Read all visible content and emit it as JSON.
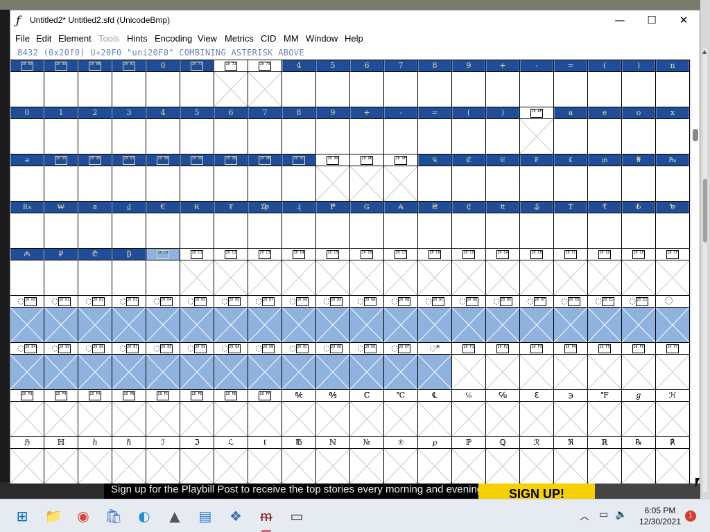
{
  "window": {
    "title": "Untitled2*  Untitled2.sfd (UnicodeBmp)",
    "app_icon": "fontforge-icon",
    "minimize": "—",
    "maximize": "☐",
    "close": "✕"
  },
  "menu": [
    {
      "label": "File",
      "enabled": true
    },
    {
      "label": "Edit",
      "enabled": true
    },
    {
      "label": "Element",
      "enabled": true
    },
    {
      "label": "Tools",
      "enabled": false
    },
    {
      "label": "Hints",
      "enabled": true
    },
    {
      "label": "Encoding",
      "enabled": true
    },
    {
      "label": "View",
      "enabled": true
    },
    {
      "label": "Metrics",
      "enabled": true
    },
    {
      "label": "CID",
      "enabled": true
    },
    {
      "label": "MM",
      "enabled": true
    },
    {
      "label": "Window",
      "enabled": true
    },
    {
      "label": "Help",
      "enabled": true
    }
  ],
  "infoline": "8432 (0x20f0) U+20F0 \"uni20F0\" COMBINING ASTERISK ABOVE",
  "grid": {
    "rows": [
      {
        "labels": [
          "▣",
          "▣",
          "▣",
          "▣",
          "0",
          "▣",
          "▣",
          "▣",
          "4",
          "5",
          "6",
          "7",
          "8",
          "9",
          "+",
          "-",
          "=",
          "(",
          ")",
          "n"
        ],
        "codes": [
          "2089",
          "208A",
          "208B",
          "208C",
          "",
          "2071",
          "2072",
          "2073",
          "",
          "",
          "",
          "",
          "",
          "",
          "",
          "",
          "",
          "",
          "",
          ""
        ],
        "header": [
          1,
          1,
          1,
          1,
          1,
          1,
          0,
          0,
          1,
          1,
          1,
          1,
          1,
          1,
          1,
          1,
          1,
          1,
          1,
          1
        ],
        "crossed": [
          0,
          0,
          0,
          0,
          0,
          0,
          1,
          1,
          0,
          0,
          0,
          0,
          0,
          0,
          0,
          0,
          0,
          0,
          0,
          0
        ]
      },
      {
        "labels": [
          "0",
          "1",
          "2",
          "3",
          "4",
          "5",
          "6",
          "7",
          "8",
          "9",
          "+",
          "-",
          "=",
          "(",
          ")",
          "▣",
          "a",
          "e",
          "o",
          "x"
        ],
        "codes": [
          "",
          "",
          "",
          "",
          "",
          "",
          "",
          "",
          "",
          "",
          "",
          "",
          "",
          "",
          "",
          "208F",
          "",
          "",
          "",
          ""
        ],
        "header": [
          1,
          1,
          1,
          1,
          1,
          1,
          1,
          1,
          1,
          1,
          1,
          1,
          1,
          1,
          1,
          0,
          1,
          1,
          1,
          1
        ],
        "crossed": [
          0,
          0,
          0,
          0,
          0,
          0,
          0,
          0,
          0,
          0,
          0,
          0,
          0,
          0,
          0,
          1,
          0,
          0,
          0,
          0
        ]
      },
      {
        "labels": [
          "ə",
          "▣",
          "▣",
          "▣",
          "▣",
          "▣",
          "▣",
          "▣",
          "▣",
          "▣",
          "▣",
          "▣",
          "₠",
          "₡",
          "₢",
          "₣",
          "₤",
          "₥",
          "₦",
          "₧"
        ],
        "codes": [
          "",
          "2095",
          "2096",
          "2097",
          "2098",
          "2099",
          "209A",
          "209B",
          "209C",
          "209D",
          "209E",
          "209F",
          "",
          "",
          "",
          "",
          "",
          "",
          "",
          ""
        ],
        "header": [
          1,
          1,
          1,
          1,
          1,
          1,
          1,
          1,
          1,
          0,
          0,
          0,
          1,
          1,
          1,
          1,
          1,
          1,
          1,
          1
        ],
        "crossed": [
          0,
          0,
          0,
          0,
          0,
          0,
          0,
          0,
          0,
          1,
          1,
          1,
          0,
          0,
          0,
          0,
          0,
          0,
          0,
          0
        ]
      },
      {
        "labels": [
          "₨",
          "₩",
          "₪",
          "₫",
          "€",
          "₭",
          "₮",
          "₯",
          "₰",
          "₱",
          "₲",
          "₳",
          "₴",
          "₵",
          "₶",
          "₷",
          "₸",
          "₹",
          "₺",
          "₻"
        ],
        "codes": [
          "",
          "",
          "",
          "",
          "",
          "",
          "",
          "",
          "",
          "",
          "",
          "",
          "",
          "",
          "",
          "",
          "",
          "",
          "",
          ""
        ],
        "header": [
          1,
          1,
          1,
          1,
          1,
          1,
          1,
          1,
          1,
          1,
          1,
          1,
          1,
          1,
          1,
          1,
          1,
          1,
          1,
          1
        ],
        "crossed": [
          0,
          0,
          0,
          0,
          0,
          0,
          0,
          0,
          0,
          0,
          0,
          0,
          0,
          0,
          0,
          0,
          0,
          0,
          0,
          0
        ]
      },
      {
        "labels": [
          "₼",
          "₽",
          "₾",
          "₿",
          "▣",
          "▣",
          "▣",
          "▣",
          "▣",
          "▣",
          "▣",
          "▣",
          "▣",
          "▣",
          "▣",
          "▣",
          "▣",
          "▣",
          "▣",
          "▣"
        ],
        "codes": [
          "",
          "",
          "",
          "",
          "20C0",
          "20C1",
          "20C2",
          "20C3",
          "20C4",
          "20C5",
          "20C6",
          "20C7",
          "20C8",
          "20C9",
          "20CA",
          "20CB",
          "20CC",
          "20CD",
          "20CE",
          "20CF"
        ],
        "header": [
          1,
          1,
          1,
          1,
          2,
          0,
          0,
          0,
          0,
          0,
          0,
          0,
          0,
          0,
          0,
          0,
          0,
          0,
          0,
          0
        ],
        "crossed": [
          0,
          0,
          0,
          0,
          0,
          1,
          1,
          1,
          1,
          1,
          1,
          1,
          1,
          1,
          1,
          1,
          1,
          1,
          1,
          1
        ]
      },
      {
        "labels": [
          "◌▣",
          "◌▣",
          "◌▣",
          "◌▣",
          "◌▣",
          "◌▣",
          "◌▣",
          "◌▣",
          "◌▣",
          "◌▣",
          "◌▣",
          "◌▣",
          "◌▣",
          "◌▣",
          "◌▣",
          "◌▣",
          "◌▣",
          "◌▣",
          "◌▣",
          "⃝"
        ],
        "codes": [
          "20D0",
          "20D1",
          "20D2",
          "20D3",
          "20D4",
          "20D5",
          "20D6",
          "20D7",
          "20D8",
          "20D9",
          "20DA",
          "20DB",
          "20DC",
          "20DD",
          "20DE",
          "20DF",
          "20E0",
          "20E1",
          "20E2",
          ""
        ],
        "header": [
          0,
          0,
          0,
          0,
          0,
          0,
          0,
          0,
          0,
          0,
          0,
          0,
          0,
          0,
          0,
          0,
          0,
          0,
          0,
          0
        ],
        "crossed": [
          1,
          1,
          1,
          1,
          1,
          1,
          1,
          1,
          1,
          1,
          1,
          1,
          1,
          1,
          1,
          1,
          1,
          1,
          1,
          1
        ],
        "selected": [
          1,
          1,
          1,
          1,
          1,
          1,
          1,
          1,
          1,
          1,
          1,
          1,
          1,
          1,
          1,
          1,
          1,
          1,
          1,
          1
        ]
      },
      {
        "labels": [
          "◌▣",
          "◌▣",
          "◌▣",
          "◌▣",
          "◌▣",
          "◌▣",
          "◌▣",
          "◌▣",
          "◌▣",
          "◌▣",
          "◌▣",
          "◌▣",
          "◌*",
          "▣",
          "▣",
          "▣",
          "▣",
          "▣",
          "▣",
          "▣"
        ],
        "codes": [
          "20E4",
          "20E5",
          "20E6",
          "20E7",
          "20E8",
          "20E9",
          "20EA",
          "20EB",
          "20EC",
          "20ED",
          "20EE",
          "20EF",
          "",
          "20F1",
          "20F2",
          "20F3",
          "20F4",
          "20F5",
          "20F6",
          "20F7"
        ],
        "header": [
          0,
          0,
          0,
          0,
          0,
          0,
          0,
          0,
          0,
          0,
          0,
          0,
          0,
          0,
          0,
          0,
          0,
          0,
          0,
          0
        ],
        "crossed": [
          1,
          1,
          1,
          1,
          1,
          1,
          1,
          1,
          1,
          1,
          1,
          1,
          1,
          1,
          1,
          1,
          1,
          1,
          1,
          1
        ],
        "selected": [
          1,
          1,
          1,
          1,
          1,
          1,
          1,
          1,
          1,
          1,
          1,
          1,
          1,
          0,
          0,
          0,
          0,
          0,
          0,
          0
        ]
      },
      {
        "labels": [
          "▣",
          "▣",
          "▣",
          "▣",
          "▣",
          "▣",
          "▣",
          "▣",
          "℀",
          "℁",
          "ℂ",
          "℃",
          "℄",
          "℅",
          "℆",
          "ℇ",
          "℈",
          "℉",
          "ℊ",
          "ℋ"
        ],
        "codes": [
          "20F8",
          "20F9",
          "20FA",
          "20FB",
          "20FC",
          "20FD",
          "20FE",
          "20FF",
          "",
          "",
          "",
          "",
          "",
          "",
          "",
          "",
          "",
          "",
          "",
          ""
        ],
        "header": [
          0,
          0,
          0,
          0,
          0,
          0,
          0,
          0,
          0,
          0,
          0,
          0,
          0,
          0,
          0,
          0,
          0,
          0,
          0,
          0
        ],
        "crossed": [
          1,
          1,
          1,
          1,
          1,
          1,
          1,
          1,
          1,
          1,
          1,
          1,
          1,
          1,
          1,
          1,
          1,
          1,
          1,
          1
        ]
      },
      {
        "labels": [
          "ℌ",
          "ℍ",
          "ℎ",
          "ℏ",
          "ℐ",
          "ℑ",
          "ℒ",
          "ℓ",
          "℔",
          "ℕ",
          "№",
          "℗",
          "℘",
          "ℙ",
          "ℚ",
          "ℛ",
          "ℜ",
          "ℝ",
          "℞",
          "℟"
        ],
        "codes": [
          "",
          "",
          "",
          "",
          "",
          "",
          "",
          "",
          "",
          "",
          "",
          "",
          "",
          "",
          "",
          "",
          "",
          "",
          "",
          ""
        ],
        "header": [
          0,
          0,
          0,
          0,
          0,
          0,
          0,
          0,
          0,
          0,
          0,
          0,
          0,
          0,
          0,
          0,
          0,
          0,
          0,
          0
        ],
        "crossed": [
          1,
          1,
          1,
          1,
          1,
          1,
          1,
          1,
          1,
          1,
          1,
          1,
          1,
          1,
          1,
          1,
          1,
          1,
          1,
          1
        ]
      }
    ]
  },
  "background": {
    "banner_text": "Sign up for the Playbill Post to receive the top stories every morning and evening.",
    "banner_button": "SIGN UP!"
  },
  "taskbar": {
    "apps": [
      {
        "name": "start-icon",
        "glyph": "⊞",
        "color": "#0067c0"
      },
      {
        "name": "file-explorer-icon",
        "glyph": "📁",
        "color": "#e8b53a"
      },
      {
        "name": "chrome-icon",
        "glyph": "◉",
        "color": "#db4437"
      },
      {
        "name": "store-icon",
        "glyph": "🛍",
        "color": "#3b74d6"
      },
      {
        "name": "edge-icon",
        "glyph": "◐",
        "color": "#1f8fd6"
      },
      {
        "name": "inkscape-icon",
        "glyph": "▲",
        "color": "#555"
      },
      {
        "name": "notepad-icon",
        "glyph": "▤",
        "color": "#2f7fd6"
      },
      {
        "name": "app-icon",
        "glyph": "❖",
        "color": "#3a6fb0"
      },
      {
        "name": "fontforge-taskbar-icon",
        "glyph": "ᵯ",
        "color": "#8b1a1a"
      },
      {
        "name": "terminal-icon",
        "glyph": "▭",
        "color": "#222"
      }
    ],
    "time": "6:05 PM",
    "date": "12/30/2021",
    "notifications": "1"
  }
}
